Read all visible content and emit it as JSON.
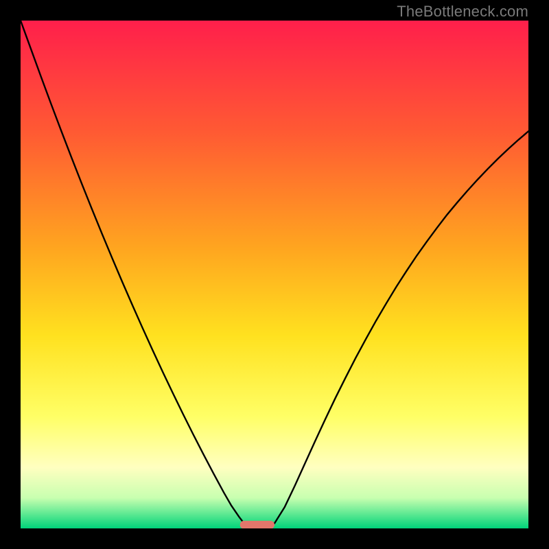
{
  "watermark": "TheBottleneck.com",
  "chart_data": {
    "type": "line",
    "title": "",
    "xlabel": "",
    "ylabel": "",
    "xlim": [
      0,
      100
    ],
    "ylim": [
      0,
      100
    ],
    "grid": false,
    "legend": false,
    "background_gradient_stops": [
      {
        "offset": 0.0,
        "color": "#ff1f4b"
      },
      {
        "offset": 0.22,
        "color": "#ff5a33"
      },
      {
        "offset": 0.45,
        "color": "#ffa61f"
      },
      {
        "offset": 0.62,
        "color": "#ffe11f"
      },
      {
        "offset": 0.78,
        "color": "#ffff66"
      },
      {
        "offset": 0.88,
        "color": "#ffffc0"
      },
      {
        "offset": 0.94,
        "color": "#c8ffb0"
      },
      {
        "offset": 0.975,
        "color": "#52e68f"
      },
      {
        "offset": 1.0,
        "color": "#00d47a"
      }
    ],
    "series": [
      {
        "name": "left-curve",
        "x": [
          0.0,
          2,
          4,
          6,
          8,
          10,
          12,
          14,
          16,
          18,
          20,
          22,
          24,
          26,
          28,
          30,
          32,
          34,
          36,
          38,
          40,
          41.5,
          43,
          44
        ],
        "y": [
          100,
          94.5,
          89,
          83.6,
          78.3,
          73.1,
          68.0,
          63.0,
          58.1,
          53.3,
          48.6,
          44.0,
          39.5,
          35.1,
          30.8,
          26.6,
          22.5,
          18.5,
          14.6,
          10.8,
          7.1,
          4.5,
          2.3,
          1.0
        ]
      },
      {
        "name": "right-curve",
        "x": [
          50,
          52,
          54,
          56,
          58,
          60,
          62,
          64,
          66,
          68,
          70,
          72,
          74,
          76,
          78,
          80,
          82,
          84,
          86,
          88,
          90,
          92,
          94,
          96,
          98,
          100
        ],
        "y": [
          1.0,
          4.2,
          8.4,
          12.8,
          17.2,
          21.5,
          25.7,
          29.7,
          33.6,
          37.3,
          40.9,
          44.3,
          47.6,
          50.7,
          53.7,
          56.5,
          59.2,
          61.8,
          64.2,
          66.5,
          68.7,
          70.8,
          72.8,
          74.7,
          76.5,
          78.2
        ]
      }
    ],
    "marker": {
      "name": "bottleneck-marker",
      "x_start": 43.2,
      "x_end": 50.0,
      "y": 0.7,
      "color": "#e4766b",
      "height_pct": 1.6
    },
    "annotations": []
  }
}
